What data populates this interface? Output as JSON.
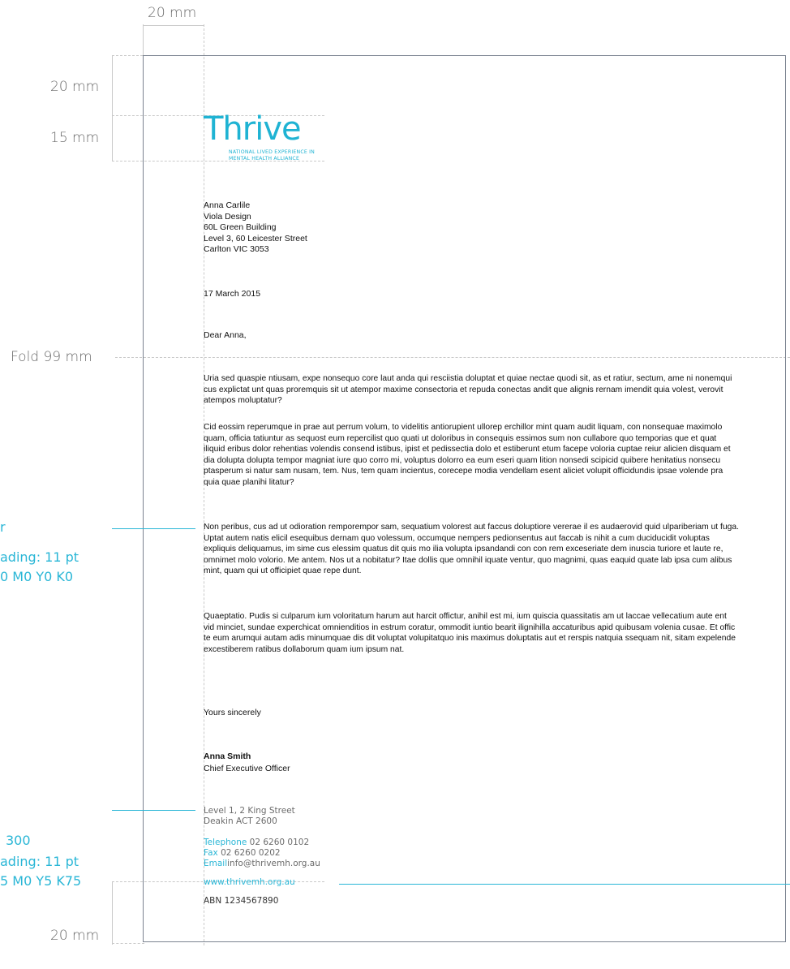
{
  "annotations": {
    "top_margin": "20 mm",
    "left_margin": "20 mm",
    "logo_height": "15 mm",
    "fold": "Fold 99 mm",
    "bottom_margin": "20 mm"
  },
  "spec_body": {
    "line1": "r",
    "line2": "ading: 11 pt",
    "line3": "0 M0 Y0 K0"
  },
  "spec_footer": {
    "line1": "300",
    "line2": "ading: 11 pt",
    "line3": "5 M0 Y5 K75"
  },
  "logo": {
    "wordmark": "Thrive",
    "tagline_1": "NATIONAL LIVED EXPERIENCE IN",
    "tagline_2": "MENTAL HEALTH ALLIANCE"
  },
  "recipient": [
    "Anna Carlile",
    "Viola Design",
    "60L Green Building",
    "Level 3, 60 Leicester Street",
    "Carlton VIC 3053"
  ],
  "date": "17 March 2015",
  "salutation": "Dear Anna,",
  "paragraphs": [
    "Uria sed quaspie ntiusam, expe nonsequo core laut anda qui resciistia doluptat et quiae nectae quodi sit, as et ratiur, sectum, ame ni nonemqui cus explictat unt quas proremquis sit ut atempor maxime consectoria et repuda conectas andit que alignis rernam imendit quia volest, verovit atempos moluptatur?",
    "Cid eossim reperumque in prae aut perrum volum, to videlitis antiorupient ullorep erchillor mint quam audit liquam, con nonsequae maximolo quam, officia tatiuntur as sequost eum repercilist quo quati ut doloribus in consequis essimos sum non cullabore quo temporias que et quat iliquid eribus dolor rehentias volendis consend istibus, ipist et pedissectia dolo et estiberunt etum facepe voloria cuptae reiur alicien disquam et dia dolupta dolupta tempor magniat iure quo corro mi, voluptus dolorro ea eum eseri quam lition nonsedi scipicid quibere henitatius nonsecu ptasperum si natur sam nusam, tem. Nus, tem quam incientus, corecepe modia vendellam esent aliciet volupit officidundis ipsae volende pra quia quae planihi litatur?",
    "Non peribus, cus ad ut odioration remporempor sam, sequatium volorest aut faccus doluptiore vererae il es audaerovid quid ulpariberiam ut fuga. Uptat autem natis elicil esequibus dernam quo volessum, occumque nempers pedionsentus aut faccab is nihit a cum duciducidit voluptas expliquis deliquamus, im sime cus elessim quatus dit quis mo ilia volupta ipsandandi con con rem exceseriate dem inuscia turiore et laute re, omnimet molo volorio. Me antem. Nos ut a nobitatur? Itae dollis que omnihil iquate ventur, quo magnimi, quas eaquid quate lab ipsa cum alibus mint, quam qui ut officipiet quae repe dunt.",
    "Quaeptatio. Pudis si culparum ium voloritatum harum aut harcit offictur, anihil est mi, ium quiscia quassitatis am ut laccae vellecatium aute ent vid minciet, sundae experchicat omnienditios in estrum coratur, ommodit iuntio bearit ilignihilla accaturibus apid quibusam volenia cusae. Et offic te eum arumqui autam adis minumquae dis dit voluptat volupitatquo inis maximus doluptatis aut et rerspis natquia ssequam nit, sitam expelende excestiberem ratibus dollaborum quam ium ipsum nat."
  ],
  "closing": "Yours sincerely",
  "signatory": {
    "name": "Anna Smith",
    "title": "Chief Executive Officer"
  },
  "footer": {
    "address_1": "Level 1, 2 King Street",
    "address_2": "Deakin ACT 2600",
    "telephone_label": "Telephone",
    "telephone": "02 6260 0102",
    "fax_label": "Fax",
    "fax": "02 6260 0202",
    "email_label": "Email",
    "email": "info@thrivemh.org.au",
    "website": "www.thrivemh.org.au",
    "abn": "ABN 1234567890"
  },
  "colors": {
    "accent": "#29b6d6",
    "page_border": "#7b8390",
    "guide": "#c9c9c9",
    "annotation_text": "#6b6b6b"
  }
}
